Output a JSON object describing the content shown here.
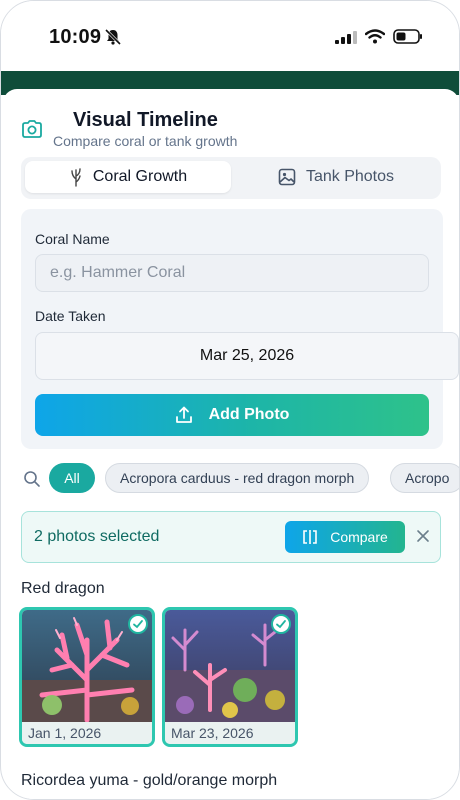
{
  "status_bar": {
    "time": "10:09"
  },
  "header": {
    "title": "Visual Timeline",
    "subtitle": "Compare coral or tank growth"
  },
  "tabs": [
    {
      "label": "Coral Growth",
      "active": true
    },
    {
      "label": "Tank Photos",
      "active": false
    }
  ],
  "form": {
    "coral_name_label": "Coral Name",
    "coral_name_placeholder": "e.g. Hammer Coral",
    "coral_name_value": "",
    "date_label": "Date Taken",
    "date_value": "Mar 25, 2026",
    "add_button": "Add Photo"
  },
  "filters": {
    "chips": [
      "All",
      "Acropora carduus - red dragon morph",
      "Acropo"
    ],
    "active_index": 0
  },
  "selection": {
    "text": "2 photos selected",
    "compare_label": "Compare"
  },
  "groups": [
    {
      "title": "Red dragon",
      "photos": [
        {
          "date": "Jan 1, 2026",
          "selected": true
        },
        {
          "date": "Mar 23, 2026",
          "selected": true
        }
      ]
    },
    {
      "title": "Ricordea yuma - gold/orange morph",
      "photos": []
    }
  ],
  "colors": {
    "accent": "#1aa9a0",
    "header_band": "#0f4d3a",
    "gradient_start": "#0ea5e9",
    "gradient_end": "#2ec28a"
  }
}
